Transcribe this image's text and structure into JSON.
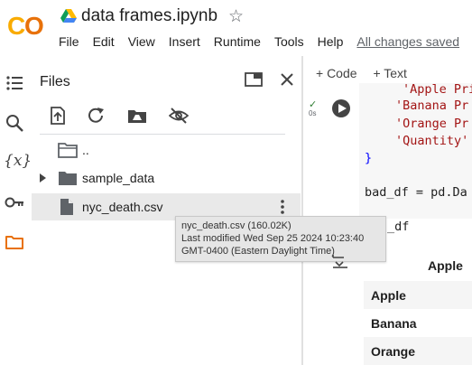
{
  "header": {
    "logo_text": "CO",
    "notebook_title": "data frames.ipynb",
    "star_glyph": "☆",
    "menu": [
      "File",
      "Edit",
      "View",
      "Insert",
      "Runtime",
      "Tools",
      "Help"
    ],
    "save_status": "All changes saved"
  },
  "rail": {
    "icons": [
      "table-of-contents-icon",
      "search-icon",
      "variables-icon",
      "secrets-key-icon",
      "files-folder-icon"
    ],
    "variables_glyph": "{x}"
  },
  "files_panel": {
    "title": "Files",
    "tools": [
      "upload-icon",
      "refresh-icon",
      "mount-drive-icon",
      "hide-files-icon"
    ],
    "tree": [
      {
        "label": "..",
        "type": "folder-up"
      },
      {
        "label": "sample_data",
        "type": "folder"
      },
      {
        "label": "nyc_death.csv",
        "type": "file"
      }
    ]
  },
  "tooltip": {
    "line1": "nyc_death.csv (160.02K)",
    "line2": "Last modified Wed Sep 25 2024 10:23:40",
    "line3": "GMT-0400 (Eastern Daylight Time)"
  },
  "notebook": {
    "add_code": "+ Code",
    "add_text": "+ Text",
    "exec_check": "✓",
    "exec_time": "0s",
    "code_lines": [
      "'Apple Pri",
      "'Banana Pr",
      "'Orange Pr",
      "'Quantity'",
      "}",
      "bad_df = pd.Da",
      "_df"
    ],
    "output": {
      "column_header": "Apple",
      "rows": [
        "Apple",
        "Banana",
        "Orange"
      ]
    }
  },
  "colors": {
    "logo_orange": "#f9ab00",
    "logo_dark_orange": "#e8710a",
    "string_red": "#a31515",
    "brace_blue": "#0000ff",
    "folder_gray": "#5f6368",
    "rail_files_orange": "#e8710a"
  }
}
